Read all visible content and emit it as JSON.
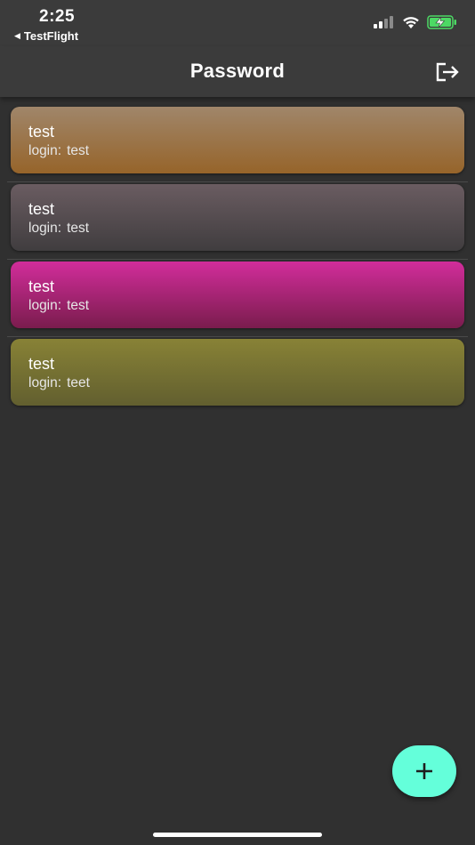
{
  "status_bar": {
    "time": "2:25",
    "back_arrow": "◀",
    "back_app": "TestFlight",
    "icons": [
      "signal-icon",
      "wifi-icon",
      "battery-charging-icon"
    ]
  },
  "app_bar": {
    "title": "Password",
    "action_icon": "logout-icon"
  },
  "items": [
    {
      "title": "test",
      "login_label": "login:",
      "login_value": "test",
      "colors": [
        "#a0866a",
        "#96642a"
      ]
    },
    {
      "title": "test",
      "login_label": "login:",
      "login_value": "test",
      "colors": [
        "#6a5c61",
        "#403d3f"
      ]
    },
    {
      "title": "test",
      "login_label": "login:",
      "login_value": "test",
      "colors": [
        "#d22d9b",
        "#7a1c4d"
      ]
    },
    {
      "title": "test",
      "login_label": "login:",
      "login_value": "teet",
      "colors": [
        "#888236",
        "#625f2f"
      ]
    }
  ],
  "fab": {
    "symbol": "+",
    "icon": "add-icon",
    "color": "#64ffda"
  },
  "colors": {
    "background": "#303030",
    "app_bar": "#3b3b3b"
  }
}
